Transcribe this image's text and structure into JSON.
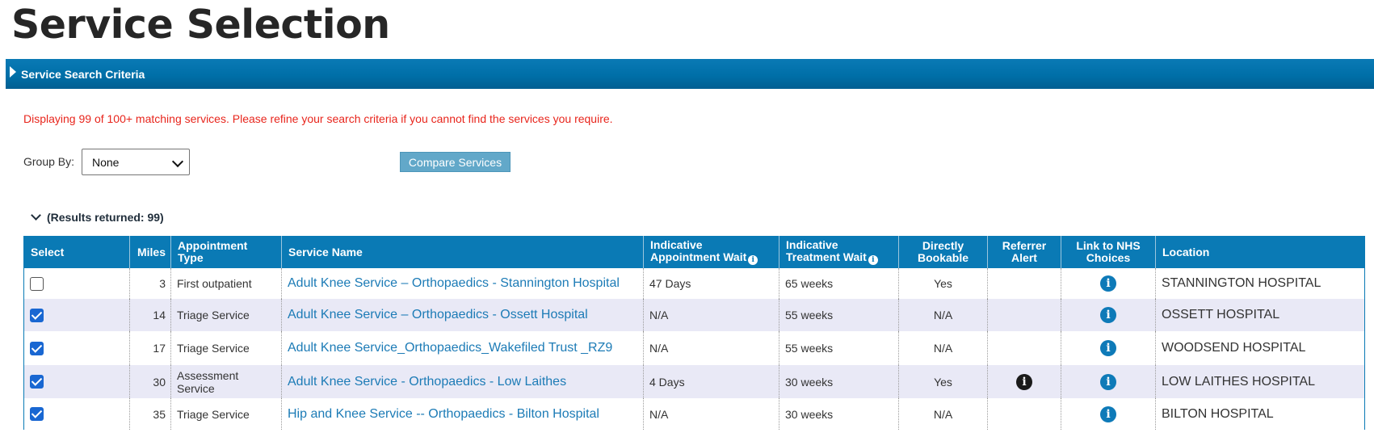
{
  "page": {
    "title": "Service Selection"
  },
  "criteria": {
    "label": "Service Search Criteria"
  },
  "warning": "Displaying 99 of 100+ matching services. Please refine your search criteria if you cannot find the services you require.",
  "group_by": {
    "label": "Group By:",
    "value": "None"
  },
  "compare_button": "Compare Services",
  "results": {
    "label": "(Results returned: 99)",
    "columns": {
      "select": "Select",
      "miles": "Miles",
      "appt_type": "Appointment Type",
      "service_name": "Service Name",
      "appt_wait": "Indicative Appointment Wait",
      "treat_wait": "Indicative Treatment Wait",
      "bookable": "Directly Bookable",
      "referrer": "Referrer Alert",
      "nhs": "Link to NHS Choices",
      "location": "Location"
    },
    "rows": [
      {
        "checked": false,
        "miles": "3",
        "type": "First outpatient",
        "service": "Adult Knee Service – Orthopaedics - Stannington Hospital",
        "appt_wait": "47 Days",
        "treat_wait": "65 weeks",
        "bookable": "Yes",
        "referrer_alert": false,
        "location": "STANNINGTON HOSPITAL"
      },
      {
        "checked": true,
        "miles": "14",
        "type": "Triage Service",
        "service": "Adult Knee Service – Orthopaedics - Ossett Hospital",
        "appt_wait": "N/A",
        "treat_wait": "55 weeks",
        "bookable": "N/A",
        "referrer_alert": false,
        "location": "OSSETT HOSPITAL"
      },
      {
        "checked": true,
        "miles": "17",
        "type": "Triage Service",
        "service": "Adult Knee Service_Orthopaedics_Wakefiled Trust _RZ9",
        "appt_wait": "N/A",
        "treat_wait": "55 weeks",
        "bookable": "N/A",
        "referrer_alert": false,
        "location": "WOODSEND HOSPITAL"
      },
      {
        "checked": true,
        "miles": "30",
        "type": "Assessment Service",
        "service": "Adult Knee Service - Orthopaedics - Low Laithes",
        "appt_wait": "4 Days",
        "treat_wait": "30 weeks",
        "bookable": "Yes",
        "referrer_alert": true,
        "location": "LOW LAITHES HOSPITAL"
      },
      {
        "checked": true,
        "miles": "35",
        "type": "Triage Service",
        "service": "Hip and Knee Service -- Orthopaedics - Bilton Hospital",
        "appt_wait": "N/A",
        "treat_wait": "30 weeks",
        "bookable": "N/A",
        "referrer_alert": false,
        "location": "BILTON HOSPITAL"
      }
    ]
  },
  "icons": {
    "info": "info-icon",
    "expand": "chevron-down-icon",
    "collapsed": "triangle-right-icon"
  },
  "colors": {
    "header": "#0a7ab5",
    "link": "#1c7bb6",
    "warning": "#e8251c",
    "row_alt": "#e9e9f6"
  }
}
